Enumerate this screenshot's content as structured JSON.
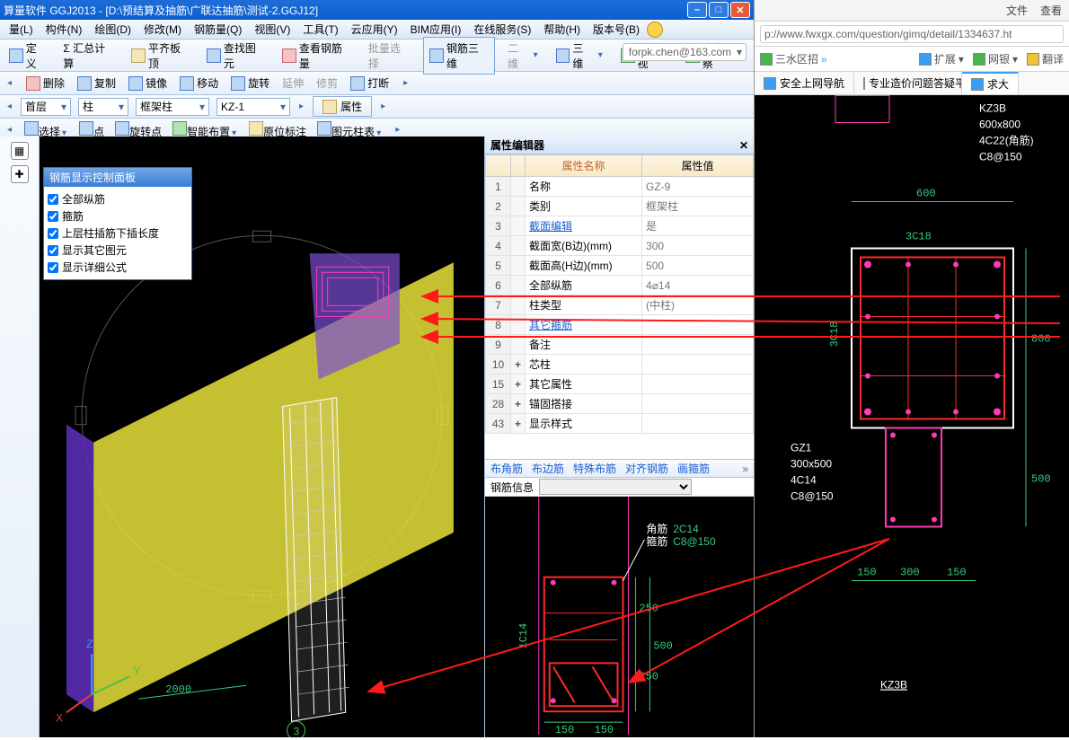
{
  "window": {
    "title": "算量软件 GGJ2013 - [D:\\预结算及抽筋\\广联达抽筋\\测试-2.GGJ12]"
  },
  "winbtns": {
    "min": "–",
    "max": "□",
    "close": "✕"
  },
  "menu": [
    "量(L)",
    "构件(N)",
    "绘图(D)",
    "修改(M)",
    "钢筋量(Q)",
    "视图(V)",
    "工具(T)",
    "云应用(Y)",
    "BIM应用(I)",
    "在线服务(S)",
    "帮助(H)",
    "版本号(B)"
  ],
  "user": "forpk.chen@163.com",
  "toolbar1": {
    "define": "定义",
    "sum": "Σ 汇总计算",
    "flat": "平齐板顶",
    "findgy": "查找图元",
    "viewsteel": "查看钢筋量",
    "batchsel": "批量选择",
    "steel3d": "钢筋三维",
    "sec2d": "二维",
    "sec3d": "三维",
    "fushi": "俯视",
    "dynview": "动态观察"
  },
  "toolbar2": {
    "del": "删除",
    "copy": "复制",
    "mirror": "镜像",
    "move": "移动",
    "rotate": "旋转",
    "extend": "延伸",
    "trim": "修剪",
    "break": "打断"
  },
  "selrow": {
    "floor": "首层",
    "cat": "柱",
    "type": "框架柱",
    "name": "KZ-1",
    "prop": "属性"
  },
  "selrow2": {
    "select": "选择",
    "point": "点",
    "rotpt": "旋转点",
    "smart": "智能布置",
    "orig": "原位标注",
    "gylist": "图元柱表"
  },
  "floatp": {
    "title": "钢筋显示控制面板",
    "items": [
      "全部纵筋",
      "箍筋",
      "上层柱插筋下插长度",
      "显示其它图元",
      "显示详细公式"
    ]
  },
  "prop": {
    "title": "属性编辑器",
    "hdr_name": "属性名称",
    "hdr_val": "属性值",
    "rows": [
      {
        "n": "1",
        "lbl": "名称",
        "val": "GZ-9"
      },
      {
        "n": "2",
        "lbl": "类别",
        "val": "框架柱"
      },
      {
        "n": "3",
        "lbl": "截面编辑",
        "val": "是",
        "link": true
      },
      {
        "n": "4",
        "lbl": "截面宽(B边)(mm)",
        "val": "300"
      },
      {
        "n": "5",
        "lbl": "截面高(H边)(mm)",
        "val": "500"
      },
      {
        "n": "6",
        "lbl": "全部纵筋",
        "val": "4⌀14"
      },
      {
        "n": "7",
        "lbl": "柱类型",
        "val": "(中柱)"
      },
      {
        "n": "8",
        "lbl": "其它箍筋",
        "val": "",
        "link": true
      },
      {
        "n": "9",
        "lbl": "备注",
        "val": ""
      },
      {
        "n": "10",
        "lbl": "芯柱",
        "val": "",
        "plus": true
      },
      {
        "n": "15",
        "lbl": "其它属性",
        "val": "",
        "plus": true
      },
      {
        "n": "28",
        "lbl": "锚固搭接",
        "val": "",
        "plus": true
      },
      {
        "n": "43",
        "lbl": "显示样式",
        "val": "",
        "plus": true
      }
    ]
  },
  "xs": {
    "tabs": [
      "布角筋",
      "布边筋",
      "特殊布筋",
      "对齐钢筋",
      "画箍筋"
    ],
    "infolbl": "钢筋信息",
    "ann": {
      "corner": "角筋",
      "cval": "2C14",
      "stirrup": "箍筋",
      "sval": "C8@150"
    },
    "dims": {
      "h1": "250",
      "h2": "250",
      "w1": "150",
      "w2": "150",
      "side": "1C14",
      "rside": "500"
    }
  },
  "axis": {
    "x": "X",
    "y": "Y",
    "z": "Z",
    "dim2000": "2000",
    "three": "3"
  },
  "browser": {
    "menu": {
      "file": "文件",
      "view": "查看"
    },
    "url": "p://www.fwxgx.com/question/gimq/detail/1334637.ht",
    "tools": {
      "ext": "扩展",
      "bank": "网银",
      "fanyi": "翻译"
    },
    "fav": {
      "sanshu": "三水区招"
    },
    "tabs": [
      {
        "t": "安全上网导航",
        "cls": ""
      },
      {
        "t": "专业造价问题答疑平台-广联",
        "cls": ""
      },
      {
        "t": "求大",
        "cls": "active"
      }
    ],
    "cad": {
      "kz": "KZ3B",
      "size": "600x800",
      "corner": "4C22(角筋)",
      "stir": "C8@150",
      "w": "600",
      "h": "800",
      "l18": "3C18",
      "l18v": "3C18",
      "gz": {
        "name": "GZ1",
        "size": "300x500",
        "bar": "4C14",
        "stir": "C8@150"
      },
      "d150a": "150",
      "d300": "300",
      "d150b": "150",
      "d500": "500",
      "kz2": "KZ3B"
    }
  }
}
